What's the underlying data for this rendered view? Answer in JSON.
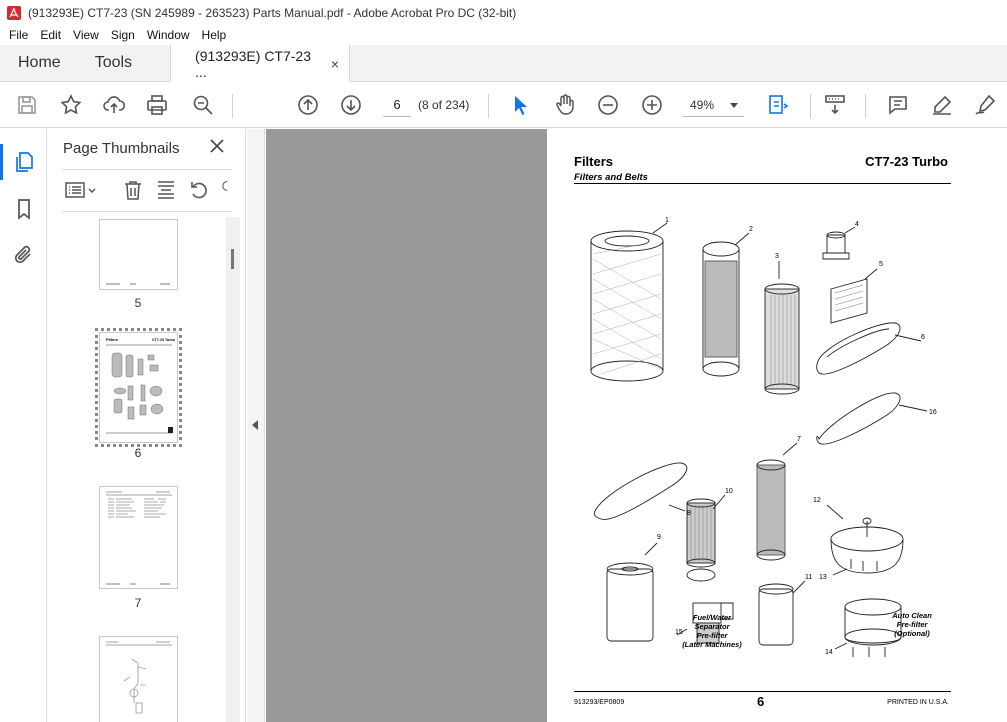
{
  "window": {
    "title": "(913293E) CT7-23 (SN 245989 - 263523) Parts Manual.pdf - Adobe Acrobat Pro DC (32-bit)"
  },
  "menu": [
    "File",
    "Edit",
    "View",
    "Sign",
    "Window",
    "Help"
  ],
  "tabs": {
    "home": "Home",
    "tools": "Tools",
    "document": "(913293E) CT7-23 ...",
    "close": "×"
  },
  "toolbar": {
    "page_current": "6",
    "page_info": "(8 of 234)",
    "zoom": "49%"
  },
  "panel": {
    "title": "Page Thumbnails",
    "thumbnails": [
      {
        "label": "5"
      },
      {
        "label": "6"
      },
      {
        "label": "7"
      },
      {
        "label": ""
      }
    ]
  },
  "page": {
    "title": "Filters",
    "model": "CT7-23 Turbo",
    "subtitle": "Filters and Belts",
    "captions": {
      "fuel_water": "Fuel/Water\nSeparator\nPre-filter\n(Later Machines)",
      "auto_clean": "Auto Clean\nPre-filter\n(Optional)"
    },
    "callouts": [
      "1",
      "2",
      "3",
      "4",
      "5",
      "6",
      "7",
      "8",
      "9",
      "10",
      "11",
      "12",
      "13",
      "14",
      "15",
      "16"
    ],
    "footer_left": "913293/EP0809",
    "footer_page": "6",
    "footer_right": "PRINTED IN U.S.A."
  },
  "colors": {
    "accent": "#1473e6",
    "acrobat_red": "#d7282f",
    "doc_background": "#999999"
  }
}
